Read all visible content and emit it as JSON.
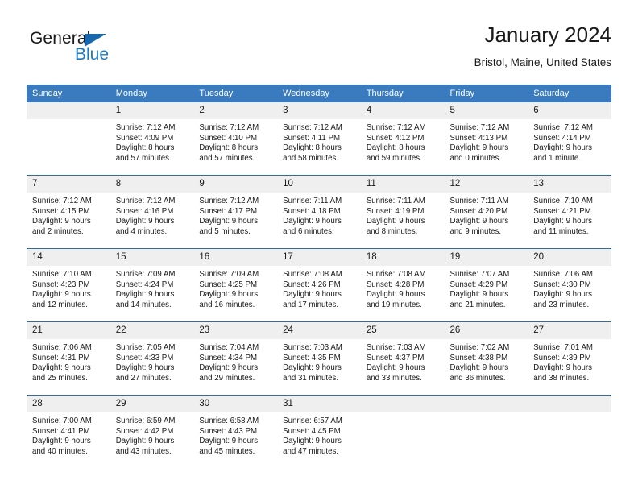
{
  "logo": {
    "text_top": "General",
    "text_bottom": "Blue",
    "triangle_color": "#1868ad",
    "blue_color": "#1d7bc4"
  },
  "header": {
    "title": "January 2024",
    "subtitle": "Bristol, Maine, United States"
  },
  "theme": {
    "header_row_bg": "#3a7bbf",
    "week_separator": "#2e6da4",
    "daynum_bg": "#efefef",
    "text": "#1a1a1a"
  },
  "weekday_headers": [
    "Sunday",
    "Monday",
    "Tuesday",
    "Wednesday",
    "Thursday",
    "Friday",
    "Saturday"
  ],
  "weeks": [
    [
      {
        "day": "",
        "sunrise": "",
        "sunset": "",
        "daylight_1": "",
        "daylight_2": ""
      },
      {
        "day": "1",
        "sunrise": "Sunrise: 7:12 AM",
        "sunset": "Sunset: 4:09 PM",
        "daylight_1": "Daylight: 8 hours",
        "daylight_2": "and 57 minutes."
      },
      {
        "day": "2",
        "sunrise": "Sunrise: 7:12 AM",
        "sunset": "Sunset: 4:10 PM",
        "daylight_1": "Daylight: 8 hours",
        "daylight_2": "and 57 minutes."
      },
      {
        "day": "3",
        "sunrise": "Sunrise: 7:12 AM",
        "sunset": "Sunset: 4:11 PM",
        "daylight_1": "Daylight: 8 hours",
        "daylight_2": "and 58 minutes."
      },
      {
        "day": "4",
        "sunrise": "Sunrise: 7:12 AM",
        "sunset": "Sunset: 4:12 PM",
        "daylight_1": "Daylight: 8 hours",
        "daylight_2": "and 59 minutes."
      },
      {
        "day": "5",
        "sunrise": "Sunrise: 7:12 AM",
        "sunset": "Sunset: 4:13 PM",
        "daylight_1": "Daylight: 9 hours",
        "daylight_2": "and 0 minutes."
      },
      {
        "day": "6",
        "sunrise": "Sunrise: 7:12 AM",
        "sunset": "Sunset: 4:14 PM",
        "daylight_1": "Daylight: 9 hours",
        "daylight_2": "and 1 minute."
      }
    ],
    [
      {
        "day": "7",
        "sunrise": "Sunrise: 7:12 AM",
        "sunset": "Sunset: 4:15 PM",
        "daylight_1": "Daylight: 9 hours",
        "daylight_2": "and 2 minutes."
      },
      {
        "day": "8",
        "sunrise": "Sunrise: 7:12 AM",
        "sunset": "Sunset: 4:16 PM",
        "daylight_1": "Daylight: 9 hours",
        "daylight_2": "and 4 minutes."
      },
      {
        "day": "9",
        "sunrise": "Sunrise: 7:12 AM",
        "sunset": "Sunset: 4:17 PM",
        "daylight_1": "Daylight: 9 hours",
        "daylight_2": "and 5 minutes."
      },
      {
        "day": "10",
        "sunrise": "Sunrise: 7:11 AM",
        "sunset": "Sunset: 4:18 PM",
        "daylight_1": "Daylight: 9 hours",
        "daylight_2": "and 6 minutes."
      },
      {
        "day": "11",
        "sunrise": "Sunrise: 7:11 AM",
        "sunset": "Sunset: 4:19 PM",
        "daylight_1": "Daylight: 9 hours",
        "daylight_2": "and 8 minutes."
      },
      {
        "day": "12",
        "sunrise": "Sunrise: 7:11 AM",
        "sunset": "Sunset: 4:20 PM",
        "daylight_1": "Daylight: 9 hours",
        "daylight_2": "and 9 minutes."
      },
      {
        "day": "13",
        "sunrise": "Sunrise: 7:10 AM",
        "sunset": "Sunset: 4:21 PM",
        "daylight_1": "Daylight: 9 hours",
        "daylight_2": "and 11 minutes."
      }
    ],
    [
      {
        "day": "14",
        "sunrise": "Sunrise: 7:10 AM",
        "sunset": "Sunset: 4:23 PM",
        "daylight_1": "Daylight: 9 hours",
        "daylight_2": "and 12 minutes."
      },
      {
        "day": "15",
        "sunrise": "Sunrise: 7:09 AM",
        "sunset": "Sunset: 4:24 PM",
        "daylight_1": "Daylight: 9 hours",
        "daylight_2": "and 14 minutes."
      },
      {
        "day": "16",
        "sunrise": "Sunrise: 7:09 AM",
        "sunset": "Sunset: 4:25 PM",
        "daylight_1": "Daylight: 9 hours",
        "daylight_2": "and 16 minutes."
      },
      {
        "day": "17",
        "sunrise": "Sunrise: 7:08 AM",
        "sunset": "Sunset: 4:26 PM",
        "daylight_1": "Daylight: 9 hours",
        "daylight_2": "and 17 minutes."
      },
      {
        "day": "18",
        "sunrise": "Sunrise: 7:08 AM",
        "sunset": "Sunset: 4:28 PM",
        "daylight_1": "Daylight: 9 hours",
        "daylight_2": "and 19 minutes."
      },
      {
        "day": "19",
        "sunrise": "Sunrise: 7:07 AM",
        "sunset": "Sunset: 4:29 PM",
        "daylight_1": "Daylight: 9 hours",
        "daylight_2": "and 21 minutes."
      },
      {
        "day": "20",
        "sunrise": "Sunrise: 7:06 AM",
        "sunset": "Sunset: 4:30 PM",
        "daylight_1": "Daylight: 9 hours",
        "daylight_2": "and 23 minutes."
      }
    ],
    [
      {
        "day": "21",
        "sunrise": "Sunrise: 7:06 AM",
        "sunset": "Sunset: 4:31 PM",
        "daylight_1": "Daylight: 9 hours",
        "daylight_2": "and 25 minutes."
      },
      {
        "day": "22",
        "sunrise": "Sunrise: 7:05 AM",
        "sunset": "Sunset: 4:33 PM",
        "daylight_1": "Daylight: 9 hours",
        "daylight_2": "and 27 minutes."
      },
      {
        "day": "23",
        "sunrise": "Sunrise: 7:04 AM",
        "sunset": "Sunset: 4:34 PM",
        "daylight_1": "Daylight: 9 hours",
        "daylight_2": "and 29 minutes."
      },
      {
        "day": "24",
        "sunrise": "Sunrise: 7:03 AM",
        "sunset": "Sunset: 4:35 PM",
        "daylight_1": "Daylight: 9 hours",
        "daylight_2": "and 31 minutes."
      },
      {
        "day": "25",
        "sunrise": "Sunrise: 7:03 AM",
        "sunset": "Sunset: 4:37 PM",
        "daylight_1": "Daylight: 9 hours",
        "daylight_2": "and 33 minutes."
      },
      {
        "day": "26",
        "sunrise": "Sunrise: 7:02 AM",
        "sunset": "Sunset: 4:38 PM",
        "daylight_1": "Daylight: 9 hours",
        "daylight_2": "and 36 minutes."
      },
      {
        "day": "27",
        "sunrise": "Sunrise: 7:01 AM",
        "sunset": "Sunset: 4:39 PM",
        "daylight_1": "Daylight: 9 hours",
        "daylight_2": "and 38 minutes."
      }
    ],
    [
      {
        "day": "28",
        "sunrise": "Sunrise: 7:00 AM",
        "sunset": "Sunset: 4:41 PM",
        "daylight_1": "Daylight: 9 hours",
        "daylight_2": "and 40 minutes."
      },
      {
        "day": "29",
        "sunrise": "Sunrise: 6:59 AM",
        "sunset": "Sunset: 4:42 PM",
        "daylight_1": "Daylight: 9 hours",
        "daylight_2": "and 43 minutes."
      },
      {
        "day": "30",
        "sunrise": "Sunrise: 6:58 AM",
        "sunset": "Sunset: 4:43 PM",
        "daylight_1": "Daylight: 9 hours",
        "daylight_2": "and 45 minutes."
      },
      {
        "day": "31",
        "sunrise": "Sunrise: 6:57 AM",
        "sunset": "Sunset: 4:45 PM",
        "daylight_1": "Daylight: 9 hours",
        "daylight_2": "and 47 minutes."
      },
      {
        "day": "",
        "sunrise": "",
        "sunset": "",
        "daylight_1": "",
        "daylight_2": ""
      },
      {
        "day": "",
        "sunrise": "",
        "sunset": "",
        "daylight_1": "",
        "daylight_2": ""
      },
      {
        "day": "",
        "sunrise": "",
        "sunset": "",
        "daylight_1": "",
        "daylight_2": ""
      }
    ]
  ]
}
